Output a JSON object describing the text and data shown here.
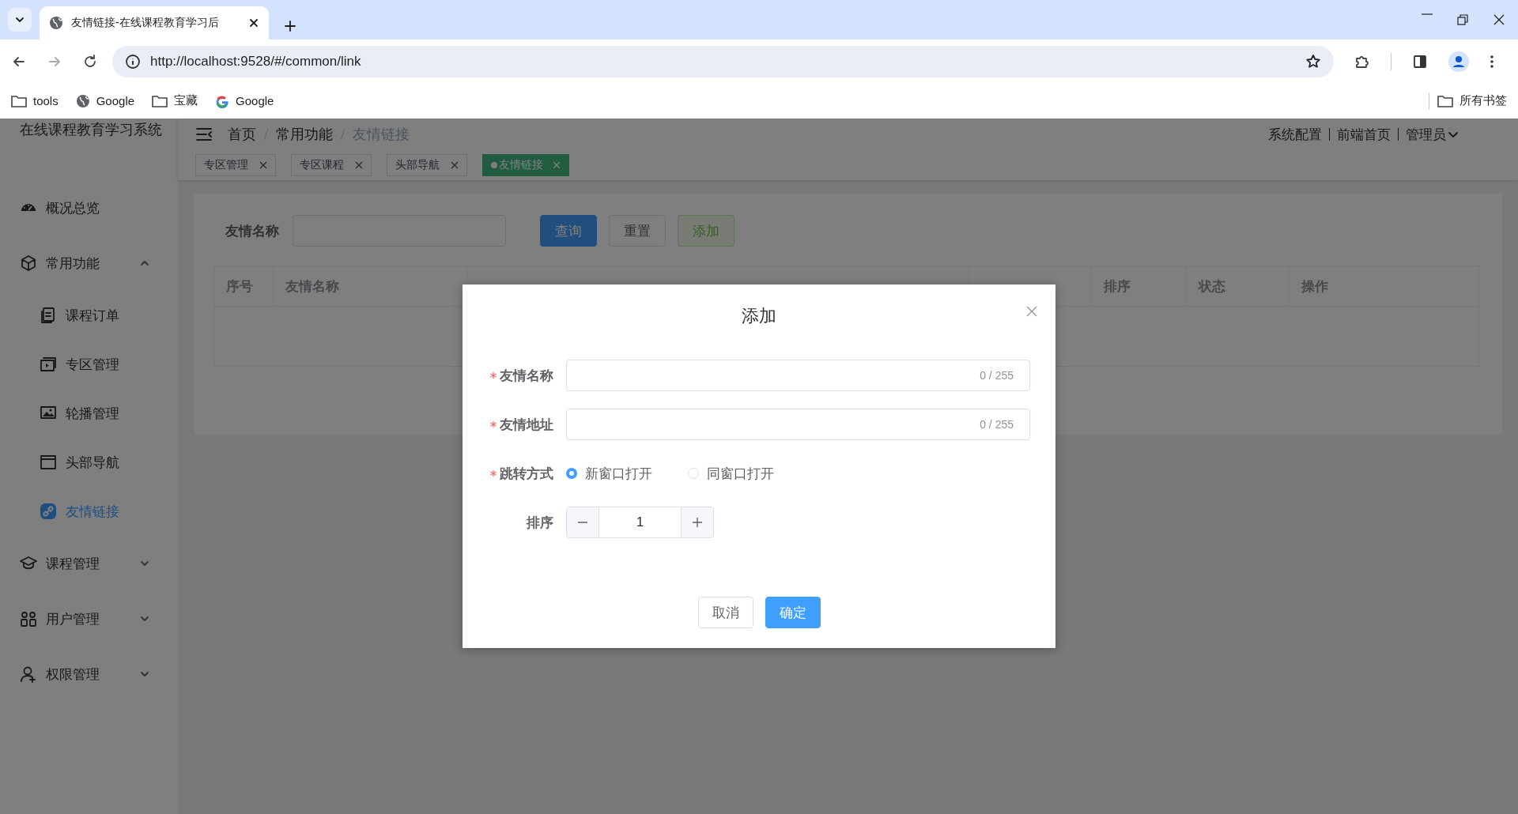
{
  "browser": {
    "tab_title": "友情链接-在线课程教育学习后",
    "url": "http://localhost:9528/#/common/link",
    "bookmarks": [
      {
        "label": "tools",
        "kind": "folder"
      },
      {
        "label": "Google",
        "kind": "globe"
      },
      {
        "label": "宝藏",
        "kind": "folder"
      },
      {
        "label": "Google",
        "kind": "google"
      }
    ],
    "all_bookmarks": "所有书签"
  },
  "app": {
    "title": "在线课程教育学习系统",
    "breadcrumb": [
      "首页",
      "常用功能",
      "友情链接"
    ],
    "header_links": [
      "系统配置",
      "前端首页"
    ],
    "user": "管理员",
    "tags": [
      {
        "label": "专区管理",
        "selected": false
      },
      {
        "label": "专区课程",
        "selected": false
      },
      {
        "label": "头部导航",
        "selected": false
      },
      {
        "label": "友情链接",
        "selected": true
      }
    ]
  },
  "sidebar": [
    {
      "label": "概况总览",
      "kind": "gauge"
    },
    {
      "label": "常用功能",
      "kind": "cube",
      "expanded": true,
      "children": [
        {
          "label": "课程订单",
          "kind": "document",
          "selected": false
        },
        {
          "label": "专区管理",
          "kind": "video",
          "selected": false
        },
        {
          "label": "轮播管理",
          "kind": "image",
          "selected": false
        },
        {
          "label": "头部导航",
          "kind": "window",
          "selected": false
        },
        {
          "label": "友情链接",
          "kind": "link",
          "selected": true
        }
      ]
    },
    {
      "label": "课程管理",
      "kind": "cap",
      "expanded": false
    },
    {
      "label": "用户管理",
      "kind": "users",
      "expanded": false
    },
    {
      "label": "权限管理",
      "kind": "user-plus",
      "expanded": false
    }
  ],
  "search": {
    "label": "友情名称"
  },
  "buttons": [
    {
      "label": "查询",
      "kind": "primary"
    },
    {
      "label": "重置",
      "kind": "default"
    },
    {
      "label": "添加",
      "kind": "success"
    }
  ],
  "table": {
    "columns": [
      "序号",
      "友情名称",
      "排序",
      "状态",
      "操作"
    ]
  },
  "dialog": {
    "title": "添加",
    "fields": [
      {
        "label": "友情名称",
        "required": true,
        "kind": "text",
        "counter": "0 / 255"
      },
      {
        "label": "友情地址",
        "required": true,
        "kind": "text",
        "counter": "0 / 255"
      },
      {
        "label": "跳转方式",
        "required": true,
        "kind": "radio",
        "options": [
          {
            "label": "新窗口打开",
            "selected": true
          },
          {
            "label": "同窗口打开",
            "selected": false
          }
        ]
      },
      {
        "label": "排序",
        "required": false,
        "kind": "number",
        "value": "1"
      }
    ],
    "buttons": [
      {
        "label": "取消",
        "kind": "default"
      },
      {
        "label": "确定",
        "kind": "primary"
      }
    ]
  }
}
